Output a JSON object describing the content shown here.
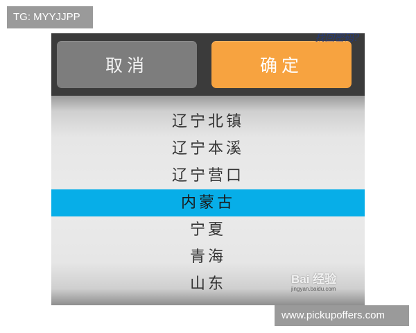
{
  "watermark": {
    "tag_text": "TG: MYYJJPP",
    "site_text": "www.pickupoffers.com",
    "baidu_logo": "Bai 经验",
    "baidu_url": "jingyan.baidu.com"
  },
  "top_peek_text": "找回密码?",
  "toolbar": {
    "cancel_label": "取消",
    "confirm_label": "确定"
  },
  "picker": {
    "items": [
      "辽宁北镇",
      "辽宁本溪",
      "辽宁营口",
      "内蒙古",
      "宁夏",
      "青海",
      "山东"
    ],
    "selected_index": 3
  },
  "colors": {
    "confirm": "#f7a340",
    "cancel": "#7d7d7d",
    "selection": "#07aee8",
    "header_bg": "#3b3b3b"
  }
}
